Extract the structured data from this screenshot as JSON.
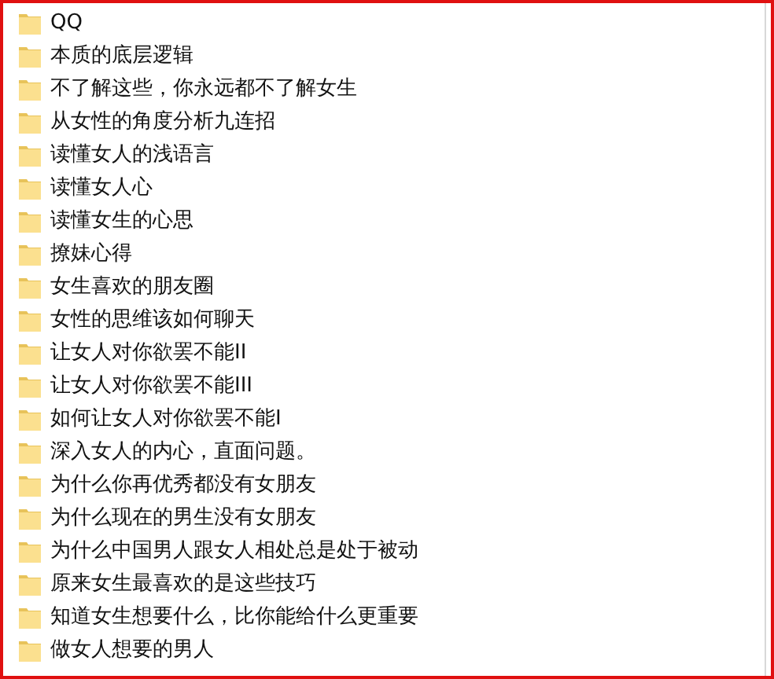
{
  "files": [
    {
      "name": "QQ"
    },
    {
      "name": "本质的底层逻辑"
    },
    {
      "name": "不了解这些，你永远都不了解女生"
    },
    {
      "name": "从女性的角度分析九连招"
    },
    {
      "name": "读懂女人的浅语言"
    },
    {
      "name": "读懂女人心"
    },
    {
      "name": "读懂女生的心思"
    },
    {
      "name": "撩妹心得"
    },
    {
      "name": "女生喜欢的朋友圈"
    },
    {
      "name": "女性的思维该如何聊天"
    },
    {
      "name": "让女人对你欲罢不能II"
    },
    {
      "name": "让女人对你欲罢不能III"
    },
    {
      "name": "如何让女人对你欲罢不能I"
    },
    {
      "name": "深入女人的内心，直面问题。"
    },
    {
      "name": "为什么你再优秀都没有女朋友"
    },
    {
      "name": "为什么现在的男生没有女朋友"
    },
    {
      "name": "为什么中国男人跟女人相处总是处于被动"
    },
    {
      "name": "原来女生最喜欢的是这些技巧"
    },
    {
      "name": "知道女生想要什么，比你能给什么更重要"
    },
    {
      "name": "做女人想要的男人"
    }
  ]
}
